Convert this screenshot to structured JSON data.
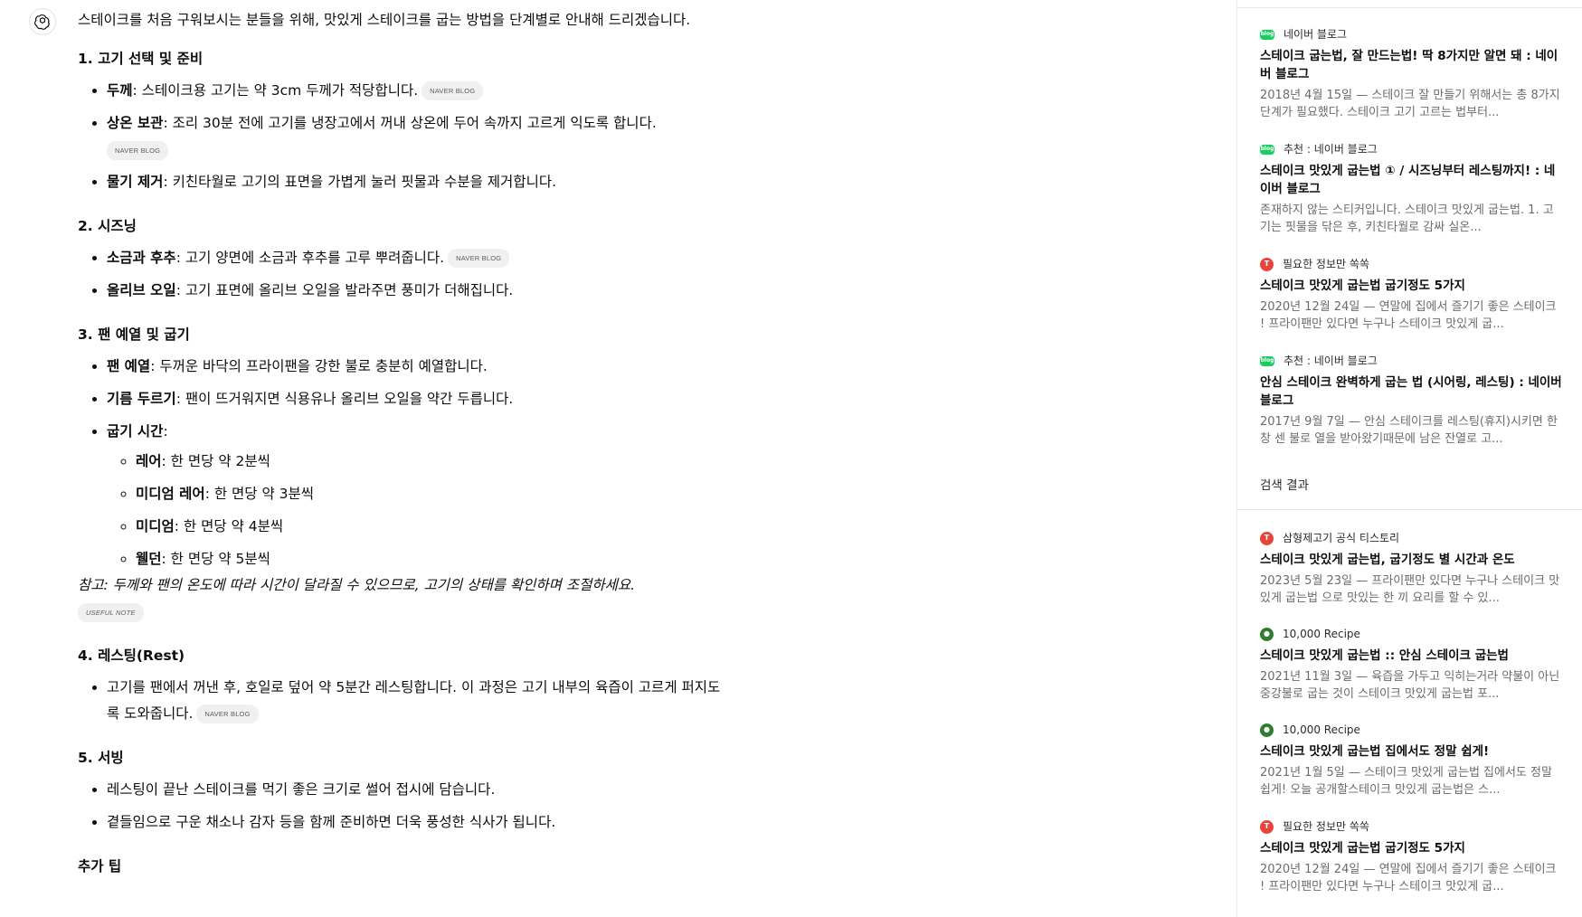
{
  "answer": {
    "intro": "스테이크를 처음 구워보시는 분들을 위해, 맛있게 스테이크를 굽는 방법을 단계별로 안내해 드리겠습니다.",
    "sections": [
      {
        "title": "1. 고기 선택 및 준비",
        "items": [
          {
            "term": "두께",
            "text": ": 스테이크용 고기는 약 3cm 두께가 적당합니다.",
            "badge": "NAVER BLOG"
          },
          {
            "term": "상온 보관",
            "text": ": 조리 30분 전에 고기를 냉장고에서 꺼내 상온에 두어 속까지 고르게 익도록 합니다.",
            "badge": "NAVER BLOG"
          },
          {
            "term": "물기 제거",
            "text": ": 키친타월로 고기의 표면을 가볍게 눌러 핏물과 수분을 제거합니다."
          }
        ]
      },
      {
        "title": "2. 시즈닝",
        "items": [
          {
            "term": "소금과 후추",
            "text": ": 고기 양면에 소금과 후추를 고루 뿌려줍니다.",
            "badge": "NAVER BLOG"
          },
          {
            "term": "올리브 오일",
            "text": ": 고기 표면에 올리브 오일을 발라주면 풍미가 더해집니다."
          }
        ]
      },
      {
        "title": "3. 팬 예열 및 굽기",
        "items": [
          {
            "term": "팬 예열",
            "text": ": 두꺼운 바닥의 프라이팬을 강한 불로 충분히 예열합니다."
          },
          {
            "term": "기름 두르기",
            "text": ": 팬이 뜨거워지면 식용유나 올리브 오일을 약간 두릅니다."
          },
          {
            "term": "굽기 시간",
            "text": ":"
          }
        ],
        "sub_items": [
          {
            "term": "레어",
            "text": ": 한 면당 약 2분씩"
          },
          {
            "term": "미디엄 레어",
            "text": ": 한 면당 약 3분씩"
          },
          {
            "term": "미디엄",
            "text": ": 한 면당 약 4분씩"
          },
          {
            "term": "웰던",
            "text": ": 한 면당 약 5분씩"
          }
        ],
        "note": "참고: 두께와 팬의 온도에 따라 시간이 달라질 수 있으므로, 고기의 상태를 확인하며 조절하세요.",
        "note_badge": "USEFUL NOTE"
      },
      {
        "title": "4. 레스팅(Rest)",
        "items": [
          {
            "term": "",
            "text": "고기를 팬에서 꺼낸 후, 호일로 덮어 약 5분간 레스팅합니다. 이 과정은 고기 내부의 육즙이 고르게 퍼지도록 도와줍니다.",
            "badge": "NAVER BLOG"
          }
        ]
      },
      {
        "title": "5. 서빙",
        "items": [
          {
            "term": "",
            "text": "레스팅이 끝난 스테이크를 먹기 좋은 크기로 썰어 접시에 담습니다."
          },
          {
            "term": "",
            "text": "곁들임으로 구운 채소나 감자 등을 함께 준비하면 더욱 풍성한 식사가 됩니다."
          }
        ]
      },
      {
        "title": "추가 팁",
        "items": []
      }
    ]
  },
  "sources": {
    "section_label": "검색 결과",
    "top": [
      {
        "source": "네이버 블로그",
        "icon": "naver",
        "title": "스테이크 굽는법, 잘 만드는법! 딱 8가지만 알면 돼 : 네이버 블로그",
        "snippet": "2018년 4월 15일 — 스테이크 잘 만들기 위해서는 총 8가지 단계가 필요했다. 스테이크 고기 고르는 법부터..."
      },
      {
        "source": "추천 : 네이버 블로그",
        "icon": "naver",
        "title": "스테이크 맛있게 굽는법 ① / 시즈닝부터 레스팅까지! : 네이버 블로그",
        "snippet": "존재하지 않는 스티커입니다. 스테이크 맛있게 굽는법. 1. 고기는 핏물을 닦은 후, 키친타월로 감싸 실온..."
      },
      {
        "source": "필요한 정보만 쏙쏙",
        "icon": "red",
        "title": "스테이크 맛있게 굽는법 굽기정도 5가지",
        "snippet": "2020년 12월 24일 — 연말에 집에서 즐기기 좋은 스테이크 ! 프라이팬만 있다면 누구나 스테이크 맛있게 굽..."
      },
      {
        "source": "추천 : 네이버 블로그",
        "icon": "naver",
        "title": "안심 스테이크 완벽하게 굽는 법 (시어링, 레스팅) : 네이버 블로그",
        "snippet": "2017년 9월 7일 — 안심 스테이크를 레스팅(휴지)시키면 한창 센 불로 열을 받아왔기때문에 남은 잔열로 고..."
      }
    ],
    "bottom": [
      {
        "source": "삼형제고기 공식 티스토리",
        "icon": "red",
        "title": "스테이크 맛있게 굽는법, 굽기정도 별 시간과 온도",
        "snippet": "2023년 5월 23일 — 프라이팬만 있다면 누구나 스테이크 맛있게 굽는법 으로 맛있는 한 끼 요리를 할 수 있..."
      },
      {
        "source": "10,000 Recipe",
        "icon": "green",
        "title": "스테이크 맛있게 굽는법 :: 안심 스테이크 굽는법",
        "snippet": "2021년 11월 3일 — 육즙을 가두고 익히는거라 약불이 아닌 중강불로 굽는 것이 스테이크 맛있게 굽는법 포..."
      },
      {
        "source": "10,000 Recipe",
        "icon": "green",
        "title": "스테이크 맛있게 굽는법 집에서도 정말 쉽게!",
        "snippet": "2021년 1월 5일 — 스테이크 맛있게 굽는법 집에서도 정말 쉽게! 오늘 공개할스테이크 맛있게 굽는법은 스..."
      },
      {
        "source": "필요한 정보만 쏙쏙",
        "icon": "red",
        "title": "스테이크 맛있게 굽는법 굽기정도 5가지",
        "snippet": "2020년 12월 24일 — 연말에 집에서 즐기기 좋은 스테이크 ! 프라이팬만 있다면 누구나 스테이크 맛있게 굽..."
      }
    ]
  }
}
